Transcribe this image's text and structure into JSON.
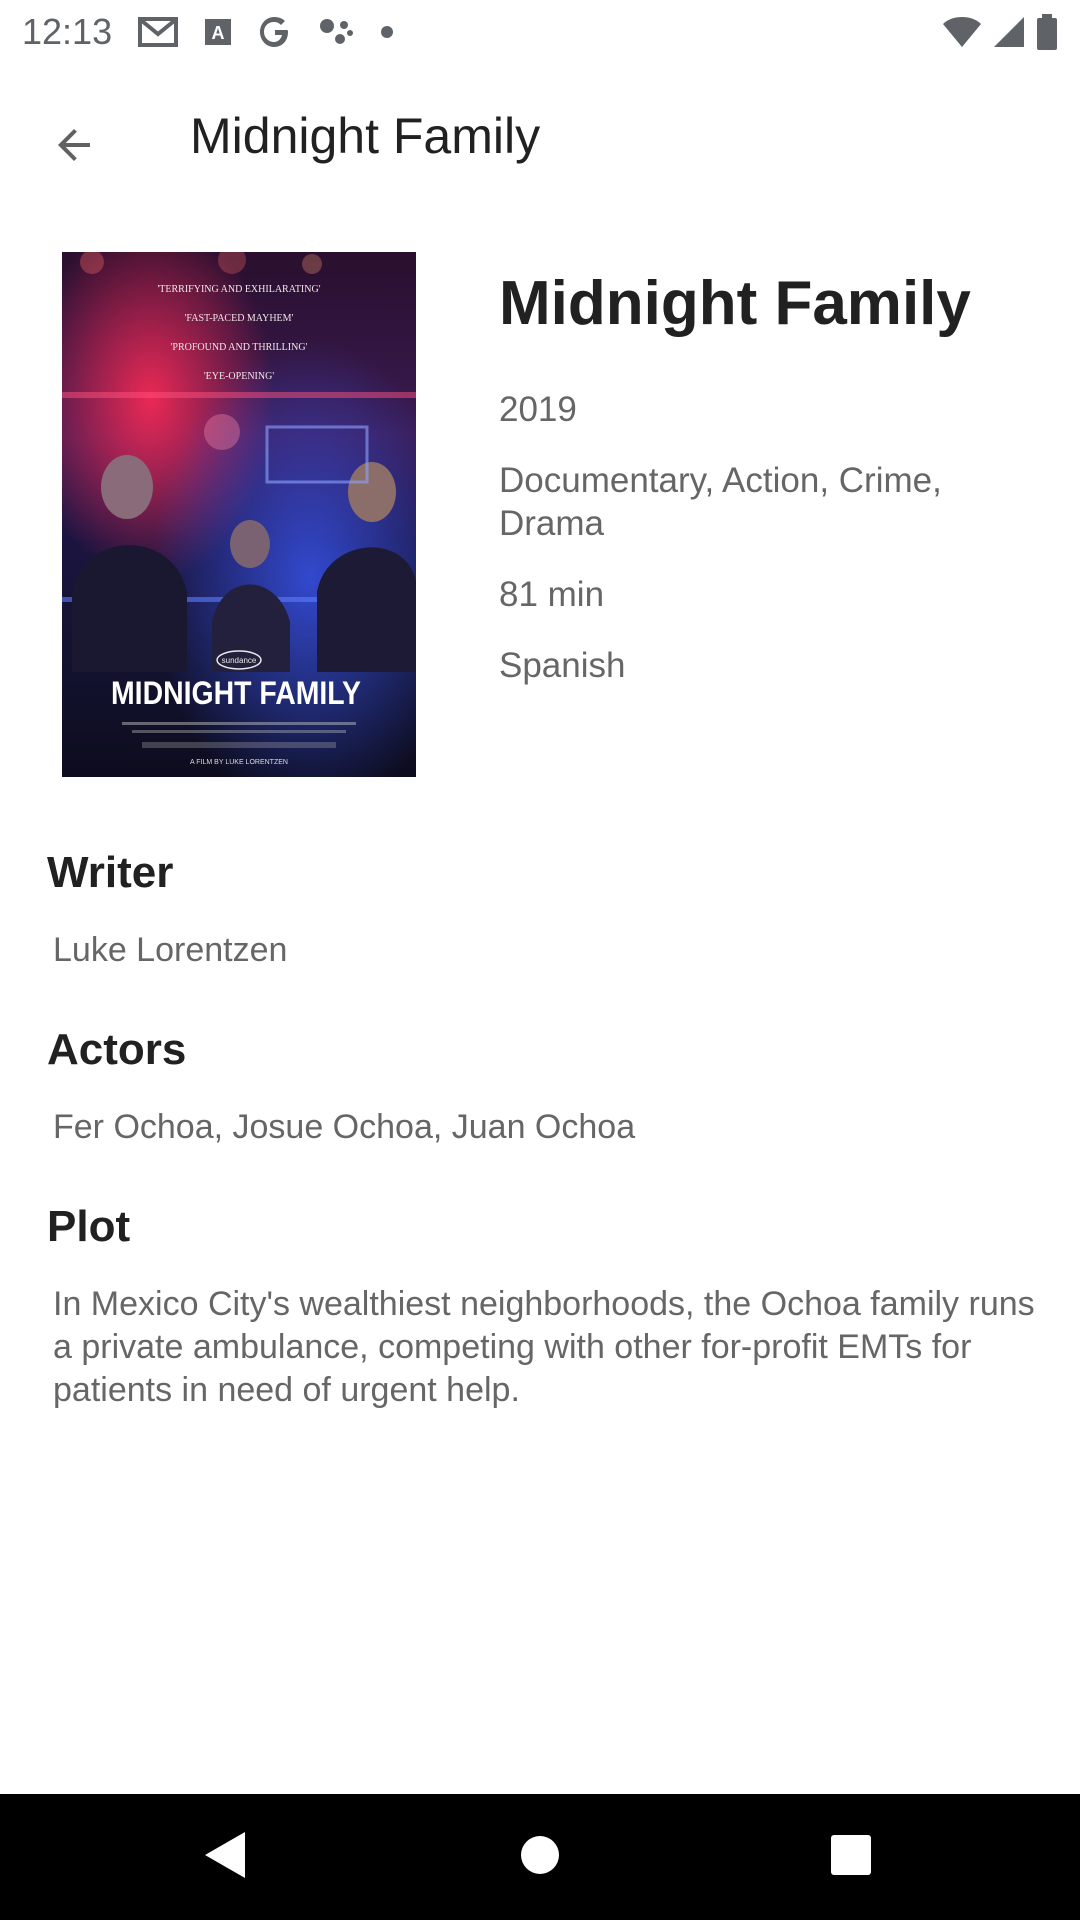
{
  "status_bar": {
    "time": "12:13",
    "left_icons": [
      "gmail-icon",
      "a-box-icon",
      "google-icon",
      "assistant-icon",
      "dot-icon"
    ],
    "right_icons": [
      "wifi-icon",
      "signal-icon",
      "battery-icon"
    ]
  },
  "app_bar": {
    "title": "Midnight Family",
    "back_icon": "arrow-back-icon"
  },
  "poster": {
    "quotes": [
      "'TERRIFYING AND EXHILARATING'",
      "'FAST-PACED MAYHEM'",
      "'PROFOUND AND THRILLING'",
      "'EYE-OPENING'"
    ],
    "badge": "sundance",
    "title": "MIDNIGHT FAMILY",
    "credit": "A FILM BY LUKE LORENTZEN"
  },
  "movie": {
    "title": "Midnight Family",
    "year": "2019",
    "genre": "Documentary, Action, Crime, Drama",
    "runtime": "81 min",
    "language": "Spanish"
  },
  "sections": {
    "writer": {
      "heading": "Writer",
      "body": "Luke Lorentzen"
    },
    "actors": {
      "heading": "Actors",
      "body": "Fer Ochoa, Josue Ochoa, Juan Ochoa"
    },
    "plot": {
      "heading": "Plot",
      "body": "In Mexico City's wealthiest neighborhoods, the Ochoa family runs a private ambulance, competing with other for-profit EMTs for patients in need of urgent help."
    }
  },
  "nav_bar": {
    "buttons": [
      "nav-back-icon",
      "nav-home-icon",
      "nav-recents-icon"
    ]
  }
}
